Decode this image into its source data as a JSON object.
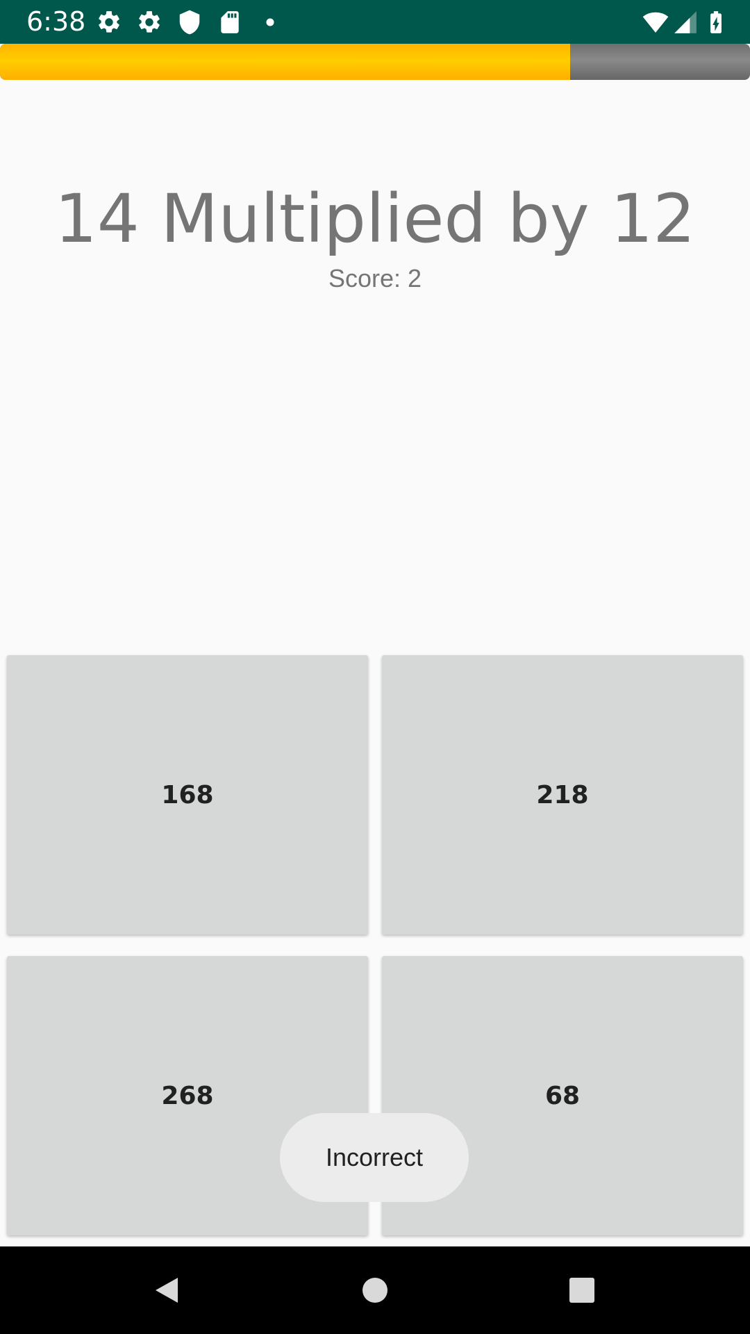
{
  "status_bar": {
    "time": "6:38",
    "left_icons": [
      "settings-icon",
      "settings-icon",
      "shield-icon",
      "sd-card-icon",
      "notification-dot-icon"
    ],
    "right_icons": [
      "wifi-icon",
      "signal-icon",
      "battery-charging-icon"
    ],
    "background_color": "#00574b"
  },
  "progress": {
    "fraction": 0.76,
    "fill_color": "#ffc400",
    "track_color": "#7a7a7a"
  },
  "question": {
    "text": "14 Multiplied by 12"
  },
  "score": {
    "text": "Score: 2"
  },
  "answers": [
    {
      "label": "168"
    },
    {
      "label": "218"
    },
    {
      "label": "268"
    },
    {
      "label": "68"
    }
  ],
  "toast": {
    "text": "Incorrect"
  },
  "nav_bar": {
    "buttons": [
      "back-icon",
      "home-icon",
      "recents-icon"
    ]
  }
}
